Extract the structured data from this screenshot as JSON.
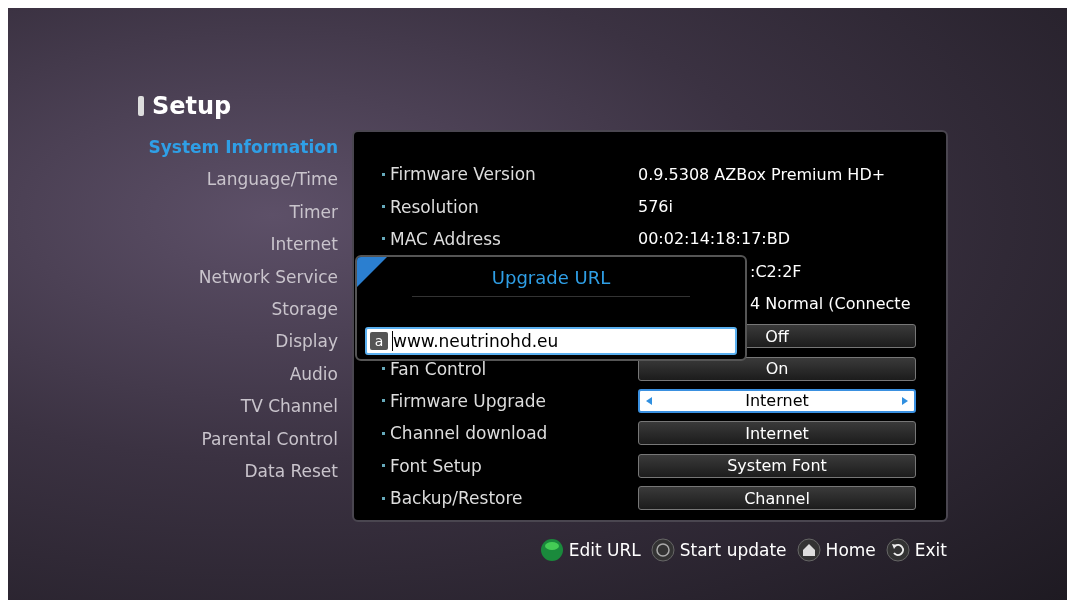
{
  "title": "Setup",
  "sidebar": {
    "items": [
      {
        "label": "System Information",
        "selected": true
      },
      {
        "label": "Language/Time",
        "selected": false
      },
      {
        "label": "Timer",
        "selected": false
      },
      {
        "label": "Internet",
        "selected": false
      },
      {
        "label": "Network Service",
        "selected": false
      },
      {
        "label": "Storage",
        "selected": false
      },
      {
        "label": "Display",
        "selected": false
      },
      {
        "label": "Audio",
        "selected": false
      },
      {
        "label": "TV Channel",
        "selected": false
      },
      {
        "label": "Parental Control",
        "selected": false
      },
      {
        "label": "Data Reset",
        "selected": false
      }
    ]
  },
  "settings": [
    {
      "kind": "text",
      "label": "Firmware Version",
      "value": "0.9.5308 AZBox Premium HD+"
    },
    {
      "kind": "text",
      "label": "Resolution",
      "value": "576i"
    },
    {
      "kind": "text",
      "label": "MAC Address",
      "value": "00:02:14:18:17:BD"
    },
    {
      "kind": "cut",
      "value": ":C2:2F"
    },
    {
      "kind": "cut",
      "value": "4 Normal (Connecte"
    },
    {
      "kind": "button",
      "value": "Off",
      "selected": false
    },
    {
      "kind": "button",
      "label": "Fan Control",
      "value": "On",
      "selected": false
    },
    {
      "kind": "selector",
      "label": "Firmware Upgrade",
      "value": "Internet",
      "selected": true
    },
    {
      "kind": "button",
      "label": "Channel download",
      "value": "Internet",
      "selected": false
    },
    {
      "kind": "button",
      "label": "Font Setup",
      "value": "System Font",
      "selected": false
    },
    {
      "kind": "button",
      "label": "Backup/Restore",
      "value": "Channel",
      "selected": false
    }
  ],
  "dialog": {
    "title": "Upgrade URL",
    "input_mode": "a",
    "value": "www.neutrinohd.eu"
  },
  "footer": [
    {
      "kind": "green",
      "label": "Edit URL"
    },
    {
      "kind": "ok",
      "label": "Start update"
    },
    {
      "kind": "home",
      "label": "Home"
    },
    {
      "kind": "back",
      "label": "Exit"
    }
  ]
}
